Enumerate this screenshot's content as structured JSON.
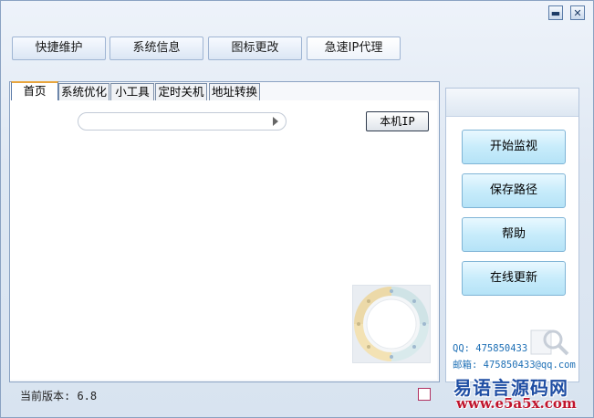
{
  "window": {
    "minimize_icon": "minimize-icon",
    "close_icon": "close-icon"
  },
  "toolbar": {
    "buttons": [
      {
        "label": "快捷维护"
      },
      {
        "label": "系统信息"
      },
      {
        "label": "图标更改"
      },
      {
        "label": "急速IP代理"
      }
    ]
  },
  "tabs": [
    {
      "label": "首页",
      "selected": true
    },
    {
      "label": "系统优化"
    },
    {
      "label": "小工具"
    },
    {
      "label": "定时关机"
    },
    {
      "label": "地址转换"
    }
  ],
  "home": {
    "url_value": "",
    "ip_button_label": "本机IP"
  },
  "sidebar": {
    "buttons": [
      {
        "label": "开始监视"
      },
      {
        "label": "保存路径"
      },
      {
        "label": "帮助"
      },
      {
        "label": "在线更新"
      }
    ],
    "qq": "QQ: 475850433",
    "email": "邮箱: 475850433@qq.com"
  },
  "status": {
    "version": "当前版本: 6.8"
  },
  "watermark": {
    "title": "易语言源码网",
    "url": "www.e5a5x.com"
  },
  "colors": {
    "accent_tab": "#e8a53d",
    "contact_text": "#1d6fb5",
    "side_button": "#c8ecfb"
  }
}
